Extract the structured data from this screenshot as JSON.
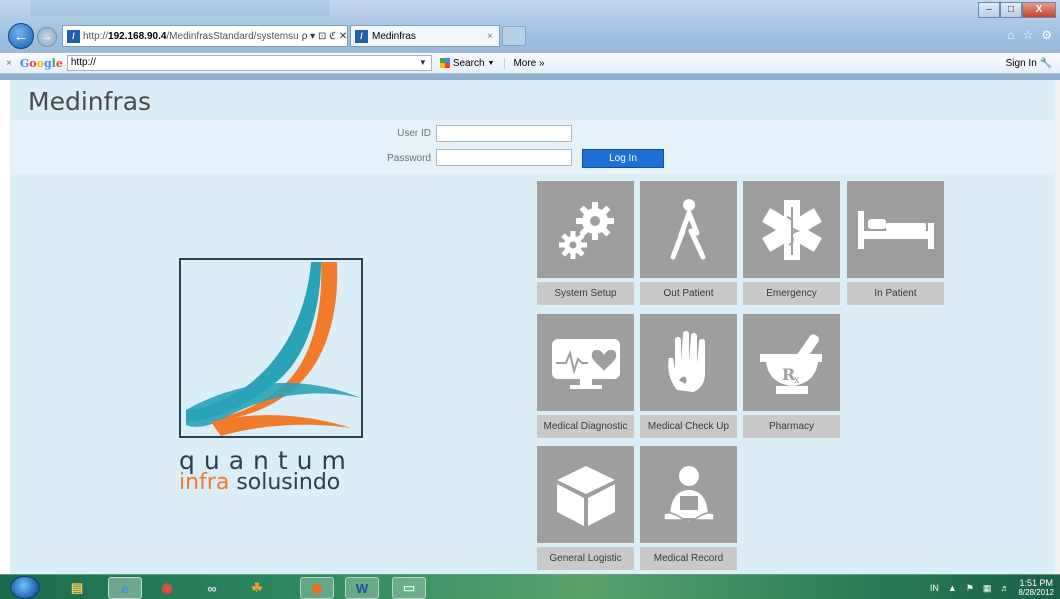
{
  "browser": {
    "address": {
      "prefix": "http://",
      "host": "192.168.90.4",
      "path": "/MedinfrasStandard/systemsu",
      "tools": "ρ ▾ ⊡ ℭ ✕"
    },
    "tab": {
      "title": "Medinfras",
      "close": "×"
    },
    "window_controls": {
      "minimize": "–",
      "maximize": "□",
      "close": "X"
    },
    "right_icons": [
      "home-icon",
      "favorites-star-icon",
      "settings-gear-icon"
    ]
  },
  "google_toolbar": {
    "close": "×",
    "logo": "Google",
    "input_value": "http://",
    "search_label": "Search",
    "more_label": "More »",
    "signin_label": "Sign In"
  },
  "app": {
    "title": "Medinfras",
    "login": {
      "user_id_label": "User ID",
      "password_label": "Password",
      "login_button": "Log In"
    },
    "logo": {
      "line1": "quantum",
      "line2_orange": "infra",
      "line2_navy": "solusindo",
      "colors": {
        "teal": "#2aa3b8",
        "orange": "#f07b2a",
        "navy": "#2b3f57"
      }
    },
    "modules": [
      {
        "label": "System Setup",
        "icon": "gears-icon"
      },
      {
        "label": "Out Patient",
        "icon": "walking-person-icon"
      },
      {
        "label": "Emergency",
        "icon": "star-of-life-icon"
      },
      {
        "label": "In Patient",
        "icon": "hospital-bed-icon"
      },
      {
        "label": "Medical Diagnostic",
        "icon": "heart-monitor-icon"
      },
      {
        "label": "Medical Check Up",
        "icon": "hand-icon"
      },
      {
        "label": "Pharmacy",
        "icon": "mortar-pestle-rx-icon"
      },
      {
        "label": "General Logistic",
        "icon": "box-icon"
      },
      {
        "label": "Medical Record",
        "icon": "person-record-icon"
      }
    ],
    "tile_color": "#9e9e9e",
    "label_color": "#c9c9c9"
  },
  "taskbar": {
    "apps": [
      "ie-icon",
      "file-manager-icon",
      "ie-icon",
      "chrome-icon",
      "network-icon",
      "paint-icon",
      "firefox-icon",
      "word-icon",
      "app-window-icon"
    ],
    "tray": {
      "lang": "IN"
    },
    "clock": {
      "time": "1:51 PM",
      "date": "8/28/2012"
    }
  }
}
